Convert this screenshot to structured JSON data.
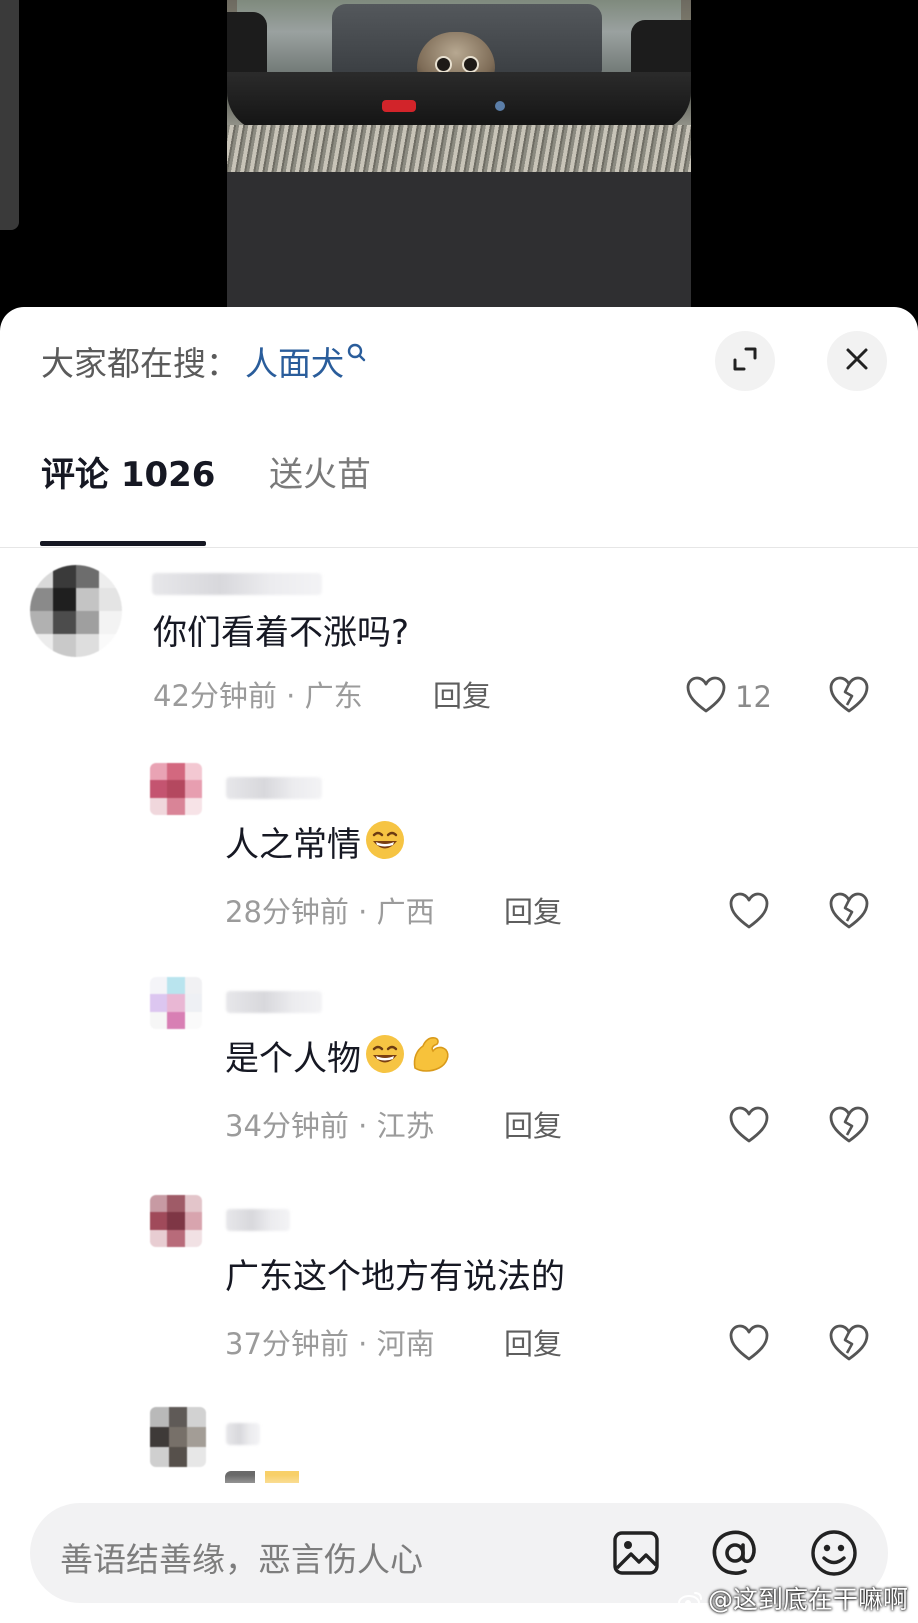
{
  "search": {
    "prefix": "大家都在搜：",
    "term": "人面犬"
  },
  "tabs": [
    {
      "label": "评论 1026",
      "active": true
    },
    {
      "label": "送火苗",
      "active": false
    }
  ],
  "comments": [
    {
      "text": "你们看着不涨吗?",
      "time": "42分钟前",
      "sep": "·",
      "location": "广东",
      "reply_label": "回复",
      "likes": "12"
    },
    {
      "text": "人之常情",
      "time": "28分钟前",
      "sep": "·",
      "location": "广西",
      "reply_label": "回复",
      "emoji": "grin-emoji"
    },
    {
      "text": "是个人物",
      "time": "34分钟前",
      "sep": "·",
      "location": "江苏",
      "reply_label": "回复",
      "emoji": "grin-emoji,flex-arm-emoji"
    },
    {
      "text": "广东这个地方有说法的",
      "time": "37分钟前",
      "sep": "·",
      "location": "河南",
      "reply_label": "回复"
    }
  ],
  "input": {
    "placeholder": "善语结善缘，恶言伤人心"
  },
  "watermark": "@这到底在干嘛啊",
  "colors": {
    "accent_link": "#2a5d9b",
    "text": "#161823",
    "meta": "#9b9b9b"
  },
  "icons": [
    "search-icon",
    "expand-icon",
    "close-icon",
    "heart-icon",
    "broken-heart-icon",
    "image-icon",
    "at-icon",
    "smiley-icon",
    "weibo-icon"
  ]
}
